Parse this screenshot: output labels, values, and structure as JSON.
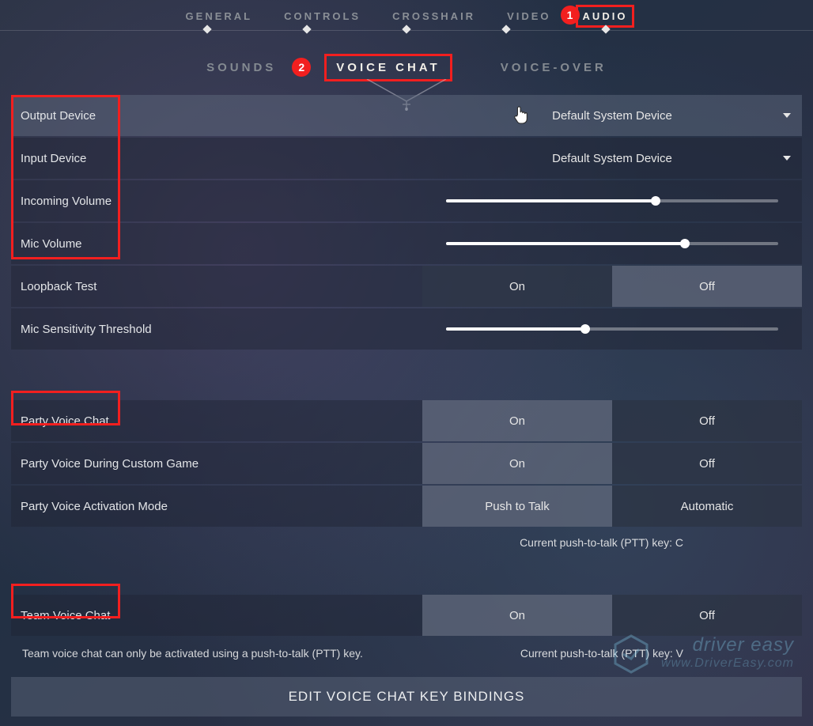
{
  "mainNav": {
    "general": "GENERAL",
    "controls": "CONTROLS",
    "crosshair": "CROSSHAIR",
    "video": "VIDEO",
    "audio": "AUDIO"
  },
  "badges": {
    "one": "1",
    "two": "2"
  },
  "subNav": {
    "sounds": "SOUNDS",
    "voiceChat": "VOICE CHAT",
    "voiceOver": "VOICE-OVER"
  },
  "rows": {
    "outputDevice": {
      "label": "Output Device",
      "value": "Default System Device"
    },
    "inputDevice": {
      "label": "Input Device",
      "value": "Default System Device"
    },
    "incomingVolume": {
      "label": "Incoming Volume",
      "percent": 63
    },
    "micVolume": {
      "label": "Mic Volume",
      "percent": 72
    },
    "loopbackTest": {
      "label": "Loopback Test",
      "on": "On",
      "off": "Off",
      "selected": "Off"
    },
    "micSensitivity": {
      "label": "Mic Sensitivity Threshold",
      "percent": 42
    },
    "partyVoiceChat": {
      "label": "Party Voice Chat",
      "on": "On",
      "off": "Off",
      "selected": "On"
    },
    "partyVoiceCustom": {
      "label": "Party Voice During Custom Game",
      "on": "On",
      "off": "Off",
      "selected": "On"
    },
    "partyActivation": {
      "label": "Party Voice Activation Mode",
      "left": "Push to Talk",
      "right": "Automatic",
      "selected": "Push to Talk"
    },
    "teamVoiceChat": {
      "label": "Team Voice Chat",
      "on": "On",
      "off": "Off",
      "selected": "On"
    }
  },
  "notes": {
    "partyPtt": "Current push-to-talk (PTT) key: C",
    "teamHint": "Team voice chat can only be activated using a push-to-talk (PTT) key.",
    "teamPtt": "Current push-to-talk (PTT) key: V"
  },
  "editBar": "EDIT VOICE CHAT KEY BINDINGS",
  "watermark": {
    "brand": "driver easy",
    "url": "www.DriverEasy.com"
  }
}
